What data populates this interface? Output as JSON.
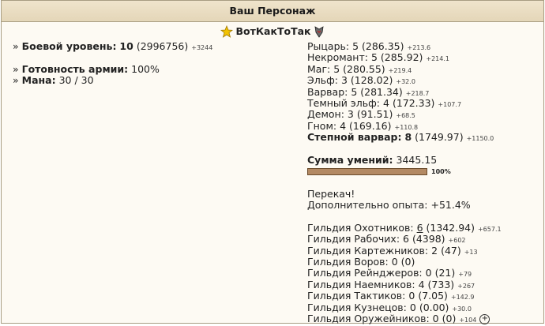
{
  "header": {
    "title": "Ваш Персонаж"
  },
  "character": {
    "name": "ВотКакТоТак"
  },
  "left": {
    "combat_label": "Боевой уровень:",
    "combat_level": "10",
    "combat_exp": "(2996756)",
    "combat_gain": "+3244",
    "army_label": "Готовность армии:",
    "army_value": "100%",
    "mana_label": "Мана:",
    "mana_value": "30 / 30"
  },
  "factions": [
    {
      "name": "Рыцарь:",
      "level": "5",
      "points": "(286.35)",
      "gain": "+213.6"
    },
    {
      "name": "Некромант:",
      "level": "5",
      "points": "(285.92)",
      "gain": "+214.1"
    },
    {
      "name": "Маг:",
      "level": "5",
      "points": "(280.55)",
      "gain": "+219.4"
    },
    {
      "name": "Эльф:",
      "level": "3",
      "points": "(128.02)",
      "gain": "+32.0"
    },
    {
      "name": "Варвар:",
      "level": "5",
      "points": "(281.34)",
      "gain": "+218.7"
    },
    {
      "name": "Темный эльф:",
      "level": "4",
      "points": "(172.33)",
      "gain": "+107.7"
    },
    {
      "name": "Демон:",
      "level": "3",
      "points": "(91.51)",
      "gain": "+68.5"
    },
    {
      "name": "Гном:",
      "level": "4",
      "points": "(169.16)",
      "gain": "+110.8"
    }
  ],
  "active_faction": {
    "name": "Степной варвар:",
    "level": "8",
    "points": "(1749.97)",
    "gain": "+1150.0"
  },
  "skills": {
    "label": "Сумма умений:",
    "value": "3445.15",
    "progress_percent": 100,
    "progress_label": "100%"
  },
  "status": {
    "perekach": "Перекач!",
    "extra_exp_label": "Дополнительно опыта:",
    "extra_exp_value": "+51.4%"
  },
  "guilds": [
    {
      "name": "Гильдия Охотников:",
      "level": "6",
      "points": "(1342.94)",
      "gain": "+657.1",
      "level_link": true
    },
    {
      "name": "Гильдия Рабочих:",
      "level": "6",
      "points": "(4398)",
      "gain": "+602"
    },
    {
      "name": "Гильдия Картежников:",
      "level": "2",
      "points": "(47)",
      "gain": "+13"
    },
    {
      "name": "Гильдия Воров:",
      "level": "0",
      "points": "(0)",
      "gain": ""
    },
    {
      "name": "Гильдия Рейнджеров:",
      "level": "0",
      "points": "(21)",
      "gain": "+79"
    },
    {
      "name": "Гильдия Наемников:",
      "level": "4",
      "points": "(733)",
      "gain": "+267"
    },
    {
      "name": "Гильдия Тактиков:",
      "level": "0",
      "points": "(7.05)",
      "gain": "+142.9"
    },
    {
      "name": "Гильдия Кузнецов:",
      "level": "0",
      "points": "(0.00)",
      "gain": "+30.0"
    },
    {
      "name": "Гильдия Оружейников:",
      "level": "0",
      "points": "(0)",
      "gain": "+104",
      "plus": "+"
    }
  ],
  "icons": {
    "star": "star-icon",
    "guild": "guild-emblem-icon"
  },
  "colors": {
    "header_bg": "#e9dcc0",
    "border": "#a89d82",
    "bar": "#b38963"
  }
}
